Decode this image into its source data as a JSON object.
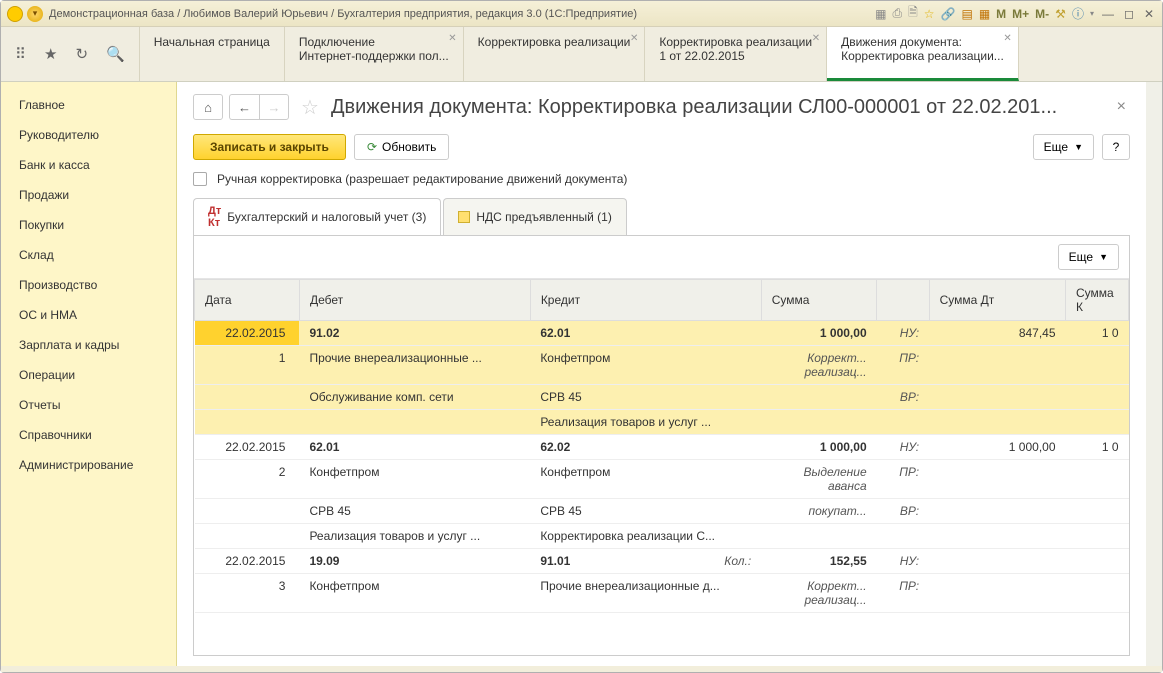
{
  "window": {
    "title": "Демонстрационная база / Любимов Валерий Юрьевич / Бухгалтерия предприятия, редакция 3.0  (1С:Предприятие)",
    "sys_m": "M",
    "sys_mplus": "M+",
    "sys_mminus": "M-"
  },
  "maintabs": [
    {
      "line1": "Начальная страница",
      "line2": ""
    },
    {
      "line1": "Подключение",
      "line2": "Интернет-поддержки пол..."
    },
    {
      "line1": "Корректировка реализации",
      "line2": ""
    },
    {
      "line1": "Корректировка реализации",
      "line2": "1 от 22.02.2015"
    },
    {
      "line1": "Движения документа:",
      "line2": "Корректировка реализации..."
    }
  ],
  "sidebar": [
    "Главное",
    "Руководителю",
    "Банк и касса",
    "Продажи",
    "Покупки",
    "Склад",
    "Производство",
    "ОС и НМА",
    "Зарплата и кадры",
    "Операции",
    "Отчеты",
    "Справочники",
    "Администрирование"
  ],
  "page": {
    "title": "Движения документа: Корректировка реализации СЛ00-000001 от 22.02.201...",
    "save_close": "Записать и закрыть",
    "refresh": "Обновить",
    "more": "Еще",
    "help": "?",
    "checkbox_label": "Ручная корректировка (разрешает редактирование движений документа)"
  },
  "subtabs": [
    {
      "label": "Бухгалтерский и налоговый учет (3)"
    },
    {
      "label": "НДС предъявленный (1)"
    }
  ],
  "table": {
    "more": "Еще",
    "headers": {
      "date": "Дата",
      "debit": "Дебет",
      "credit": "Кредит",
      "sum": "Сумма",
      "sumdt": "Сумма Дт",
      "sumk": "Сумма К"
    },
    "rows": [
      {
        "g": 1,
        "r": 1,
        "date": "22.02.2015",
        "debit": "91.02",
        "credit": "62.01",
        "sum": "1 000,00",
        "lbl": "НУ:",
        "sumdt": "847,45",
        "sumk": "1 0"
      },
      {
        "g": 1,
        "r": 2,
        "date": "1",
        "debit": "Прочие внереализационные ...",
        "credit": "Конфетпром",
        "sum": "Коррект...",
        "sum2": "реализац...",
        "lbl": "ПР:",
        "sumdt": "",
        "sumk": ""
      },
      {
        "g": 1,
        "r": 3,
        "date": "",
        "debit": "Обслуживание комп. сети",
        "credit": "СРВ 45",
        "sum": "",
        "lbl": "ВР:",
        "sumdt": "",
        "sumk": ""
      },
      {
        "g": 1,
        "r": 4,
        "date": "",
        "debit": "",
        "credit": "Реализация товаров и услуг ...",
        "sum": "",
        "lbl": "",
        "sumdt": "",
        "sumk": ""
      },
      {
        "g": 2,
        "r": 1,
        "date": "22.02.2015",
        "debit": "62.01",
        "credit": "62.02",
        "sum": "1 000,00",
        "lbl": "НУ:",
        "sumdt": "1 000,00",
        "sumk": "1 0"
      },
      {
        "g": 2,
        "r": 2,
        "date": "2",
        "debit": "Конфетпром",
        "credit": "Конфетпром",
        "sum": "Выделение",
        "sum2": "аванса",
        "lbl": "ПР:",
        "sumdt": "",
        "sumk": ""
      },
      {
        "g": 2,
        "r": 3,
        "date": "",
        "debit": "СРВ 45",
        "credit": "СРВ 45",
        "sum": "покупат...",
        "lbl": "ВР:",
        "sumdt": "",
        "sumk": ""
      },
      {
        "g": 2,
        "r": 4,
        "date": "",
        "debit": "Реализация товаров и услуг ...",
        "credit": "Корректировка реализации С...",
        "sum": "",
        "lbl": "",
        "sumdt": "",
        "sumk": ""
      },
      {
        "g": 3,
        "r": 1,
        "date": "22.02.2015",
        "debit": "19.09",
        "credit": "91.01",
        "creditExtra": "Кол.:",
        "sum": "152,55",
        "lbl": "НУ:",
        "sumdt": "",
        "sumk": ""
      },
      {
        "g": 3,
        "r": 2,
        "date": "3",
        "debit": "Конфетпром",
        "credit": "Прочие внереализационные д...",
        "sum": "Коррект...",
        "sum2": "реализац...",
        "lbl": "ПР:",
        "sumdt": "",
        "sumk": ""
      }
    ]
  }
}
